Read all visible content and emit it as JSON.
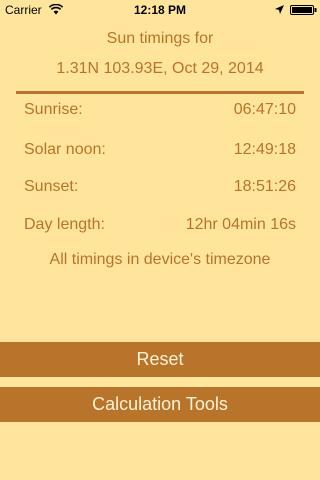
{
  "status_bar": {
    "carrier": "Carrier",
    "time": "12:18 PM"
  },
  "header": {
    "line1": "Sun timings for",
    "line2": "1.31N 103.93E, Oct 29, 2014"
  },
  "rows": [
    {
      "label": "Sunrise:",
      "value": "06:47:10"
    },
    {
      "label": "Solar noon:",
      "value": "12:49:18"
    },
    {
      "label": "Sunset:",
      "value": "18:51:26"
    },
    {
      "label": "Day length:",
      "value": "12hr 04min 16s"
    }
  ],
  "note": "All timings in device's timezone",
  "buttons": {
    "reset": "Reset",
    "tools": "Calculation Tools"
  },
  "colors": {
    "background": "#FFE59C",
    "accent": "#B8742A",
    "button_text": "#FFF3D6"
  }
}
